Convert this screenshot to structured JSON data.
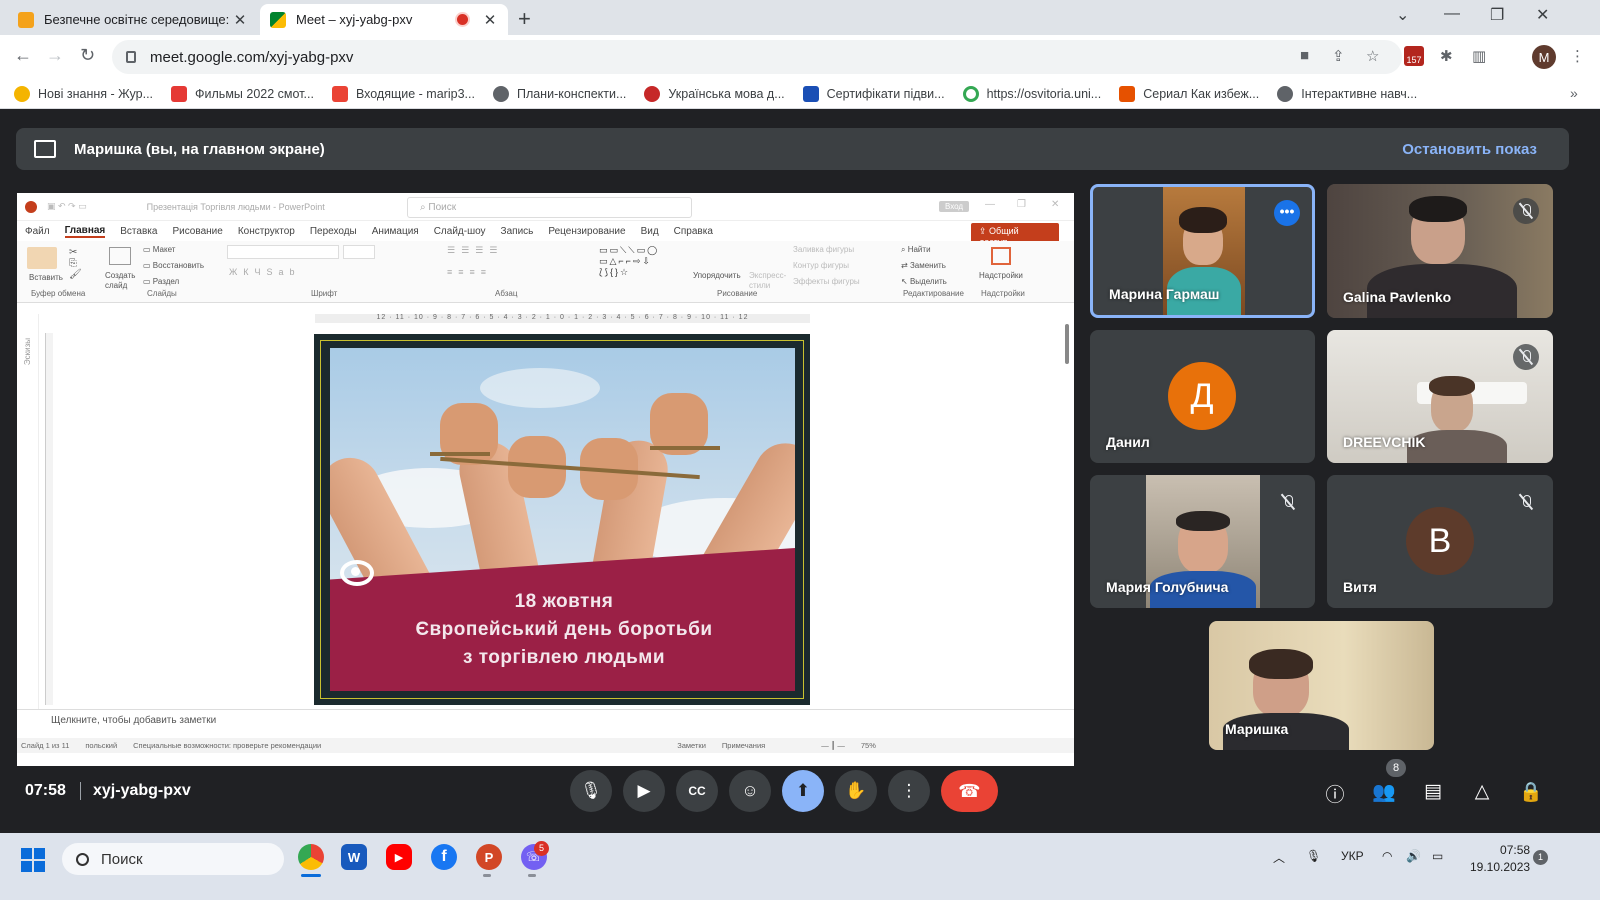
{
  "browser": {
    "tabs": [
      {
        "title": "Безпечне освітнє середовище:",
        "state": "inactive"
      },
      {
        "title": "Meet – xyj-yabg-pxv",
        "state": "active"
      }
    ],
    "url": "meet.google.com/xyj-yabg-pxv",
    "extension_badge": "157",
    "profile_initial": "M",
    "bookmarks": [
      {
        "label": "Нові знання - Жур...",
        "color": "#f4b400"
      },
      {
        "label": "Фильмы 2022 смот...",
        "color": "#e53935"
      },
      {
        "label": "Входящие - marip3...",
        "color": "#ea4335"
      },
      {
        "label": "Плани-конспекти...",
        "color": "#5f6368"
      },
      {
        "label": "Українська мова д...",
        "color": "#c62828"
      },
      {
        "label": "Сертифікати підви...",
        "color": "#1a4fb5"
      },
      {
        "label": "https://osvitoria.uni...",
        "color": "#34a853"
      },
      {
        "label": "Сериал Как избеж...",
        "color": "#e65100"
      },
      {
        "label": "Інтерактивне навч...",
        "color": "#5f6368"
      }
    ]
  },
  "meet": {
    "presenting_banner": "Маришка (вы, на главном экране)",
    "stop_presenting": "Остановить показ",
    "time": "07:58",
    "meeting_code": "xyj-yabg-pxv",
    "participant_count": "8",
    "participants": [
      {
        "name": "Марина Гармаш",
        "type": "video",
        "speaking": true
      },
      {
        "name": "Galina Pavlenko",
        "type": "video",
        "muted": true
      },
      {
        "name": "Данил",
        "type": "avatar",
        "initial": "Д",
        "color": "#e8710a"
      },
      {
        "name": "DREEVCHIK",
        "type": "video",
        "muted": true
      },
      {
        "name": "Мария Голубнича",
        "type": "video",
        "muted": true
      },
      {
        "name": "Витя",
        "type": "avatar",
        "initial": "В",
        "color": "#5d3b2b",
        "muted": true
      },
      {
        "name": "Маришка",
        "type": "video"
      }
    ]
  },
  "powerpoint": {
    "doc_title": "Презентація Торгівля людьми - PowerPoint",
    "search_placeholder": "Поиск",
    "login": "Вход",
    "share": "Общий доступ",
    "menu": [
      "Файл",
      "Главная",
      "Вставка",
      "Рисование",
      "Конструктор",
      "Переходы",
      "Анимация",
      "Слайд-шоу",
      "Запись",
      "Рецензирование",
      "Вид",
      "Справка"
    ],
    "ribbon": {
      "paste": "Вставить",
      "new_slide": "Создать слайд",
      "layout": "Макет",
      "reset": "Восстановить",
      "section": "Раздел",
      "arrange": "Упорядочить",
      "quick_styles": "Экспресс-стили",
      "shape_fill": "Заливка фигуры",
      "shape_outline": "Контур фигуры",
      "shape_effects": "Эффекты фигуры",
      "find": "Найти",
      "replace": "Заменить",
      "select": "Выделить",
      "addins": "Надстройки"
    },
    "ribbon_groups": [
      "Буфер обмена",
      "Слайды",
      "Шрифт",
      "Абзац",
      "Рисование",
      "Редактирование",
      "Надстройки"
    ],
    "ruler": "12 · 11 · 10 · 9 · 8 · 7 · 6 · 5 · 4 · 3 · 2 · 1 · 0 · 1 · 2 · 3 · 4 · 5 · 6 · 7 · 8 · 9 · 10 · 11 · 12",
    "thumbnails_label": "Эскизы",
    "notes_placeholder": "Щелкните, чтобы добавить заметки",
    "status": {
      "slide": "Слайд 1 из 11",
      "lang": "польский",
      "accessibility": "Специальные возможности: проверьте рекомендации",
      "notes": "Заметки",
      "comments": "Примечания",
      "zoom": "75%"
    },
    "slide_text": [
      "18 жовтня",
      "Європейський день боротьби",
      "з торгівлею людьми"
    ]
  },
  "taskbar": {
    "search": "Поиск",
    "viber_badge": "5",
    "language": "УКР",
    "time": "07:58",
    "date": "19.10.2023",
    "notification_count": "1"
  }
}
